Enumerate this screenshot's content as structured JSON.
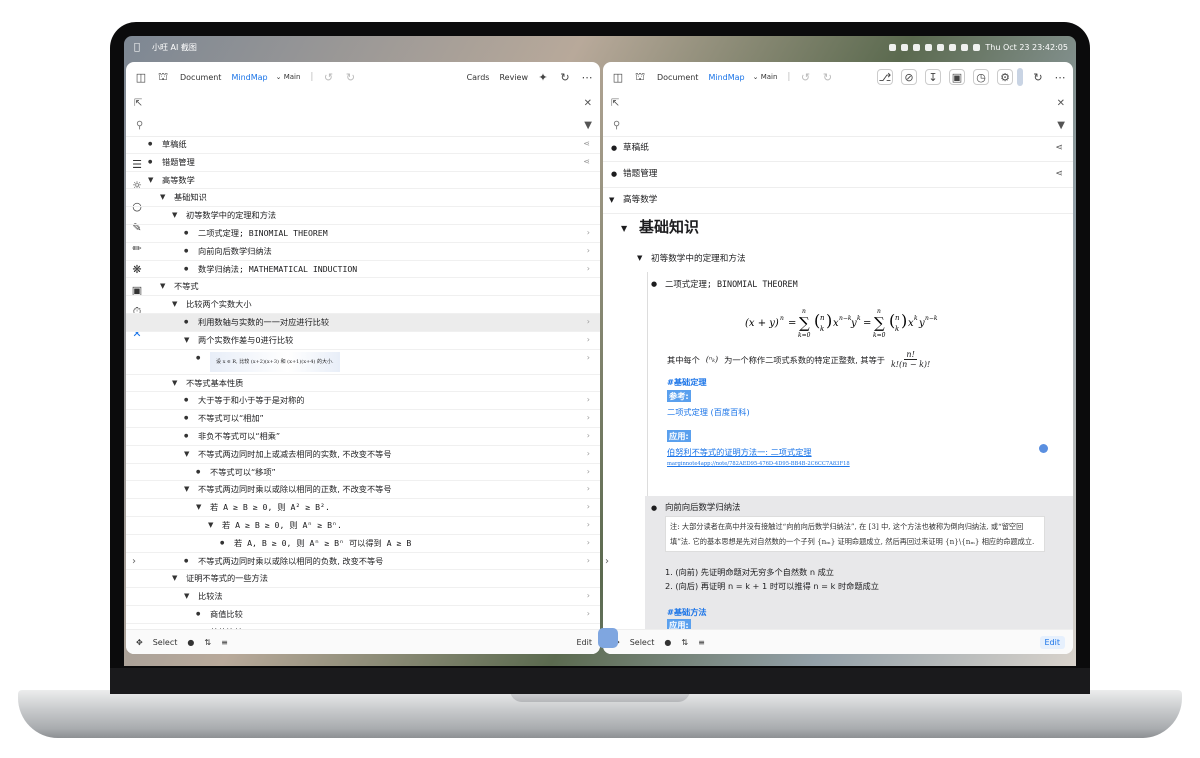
{
  "menubar": {
    "app_name": "小旺 AI 截图",
    "datetime": "Thu Oct 23  23:42:05"
  },
  "left": {
    "toolbar": {
      "document": "Document",
      "mindmap": "MindMap",
      "main": "Main",
      "cards": "Cards",
      "review": "Review"
    },
    "tree": [
      {
        "depth": 0,
        "label": "草稿纸",
        "bullet": true
      },
      {
        "depth": 0,
        "label": "错题管理",
        "bullet": true
      },
      {
        "depth": 0,
        "label": "高等数学",
        "toggle": true
      },
      {
        "depth": 1,
        "label": "基础知识",
        "toggle": true
      },
      {
        "depth": 2,
        "label": "初等数学中的定理和方法",
        "toggle": true
      },
      {
        "depth": 3,
        "label": "二项式定理; BINOMIAL THEOREM",
        "bullet": true
      },
      {
        "depth": 3,
        "label": "向前向后数学归纳法",
        "bullet": true
      },
      {
        "depth": 3,
        "label": "数学归纳法; MATHEMATICAL INDUCTION",
        "bullet": true
      },
      {
        "depth": 1,
        "label": "不等式",
        "toggle": true
      },
      {
        "depth": 2,
        "label": "比较两个实数大小",
        "toggle": true
      },
      {
        "depth": 3,
        "label": "利用数轴与实数的一一对应进行比较",
        "bullet": true,
        "highlight": true
      },
      {
        "depth": 3,
        "label": "两个实数作差与0进行比较",
        "toggle": true
      },
      {
        "depth": 4,
        "label": "设 x ∈ R, 比较 (x+2)(x+3) 和 (x+1)(x+4) 的大小.",
        "bullet": true,
        "image": true
      },
      {
        "depth": 2,
        "label": "不等式基本性质",
        "toggle": true
      },
      {
        "depth": 3,
        "label": "大于等于和小于等于是对称的",
        "bullet": true
      },
      {
        "depth": 3,
        "label": "不等式可以“相加”",
        "bullet": true
      },
      {
        "depth": 3,
        "label": "非负不等式可以“相乘”",
        "bullet": true
      },
      {
        "depth": 3,
        "label": "不等式两边同时加上或减去相同的实数, 不改变不等号",
        "toggle": true
      },
      {
        "depth": 4,
        "label": "不等式可以“移项”",
        "bullet": true
      },
      {
        "depth": 3,
        "label": "不等式两边同时乘以或除以相同的正数, 不改变不等号",
        "toggle": true
      },
      {
        "depth": 4,
        "label": "若 A ≥ B ≥ 0, 则 A² ≥ B².",
        "toggle": true
      },
      {
        "depth": 5,
        "label": "若 A ≥ B ≥ 0, 则 Aⁿ ≥ Bⁿ.",
        "toggle": true
      },
      {
        "depth": 6,
        "label": "若 A, B ≥ 0, 则 Aⁿ ≥ Bⁿ 可以得到 A ≥ B",
        "bullet": true
      },
      {
        "depth": 3,
        "label": "不等式两边同时乘以或除以相同的负数, 改变不等号",
        "bullet": true
      },
      {
        "depth": 2,
        "label": "证明不等式的一些方法",
        "toggle": true
      },
      {
        "depth": 3,
        "label": "比较法",
        "toggle": true
      },
      {
        "depth": 4,
        "label": "商值比较",
        "bullet": true
      },
      {
        "depth": 4,
        "label": "差值比较",
        "bullet": true
      }
    ],
    "bottom": {
      "select": "Select",
      "edit": "Edit"
    }
  },
  "right": {
    "toolbar": {
      "document": "Document",
      "mindmap": "MindMap",
      "main": "Main"
    },
    "top_items": [
      "草稿纸",
      "错题管理",
      "高等数学"
    ],
    "section_title": "基础知识",
    "subsection": "初等数学中的定理和方法",
    "binomial": {
      "title": "二项式定理; BINOMIAL THEOREM",
      "formula": "(x + y)ⁿ = Σₖ₌₀ⁿ (n k) xⁿ⁻ᵏ yᵏ = Σₖ₌₀ⁿ (n k) xᵏ yⁿ⁻ᵏ",
      "desc_a": "其中每个",
      "desc_b": "为一个称作二项式系数的特定正整数, 其等于",
      "desc_frac": "n! / k!(n − k)!",
      "tag": "#基础定理",
      "ref_label": "参考:",
      "ref_text": "二项式定理 (百度百科)",
      "app_label": "应用:",
      "app_link": "伯努利不等式的证明方法一: 二项式定理",
      "app_url": "marginnote4app://note/782AED95-476D-4D95-BB4B-2C6CC7A83F18"
    },
    "induction": {
      "title": "向前向后数学归纳法",
      "note": "注: 大部分读者在高中并没有接触过“向前向后数学归纳法”, 在 [3] 中, 这个方法也被称为倒向归纳法, 或“留空回填”法. 它的基本思想是先对自然数的一个子列 {nₘ} 证明命题成立, 然后再回过来证明 {n}\\{nₘ} 相应的命题成立.",
      "step1": "1.  (向前) 先证明命题对无穷多个自然数 n 成立",
      "step2": "2.  (向后) 再证明 n = k + 1 时可以推得 n = k 时命题成立",
      "tag": "#基础方法",
      "app_label": "应用:"
    },
    "bottom": {
      "select": "Select",
      "edit": "Edit"
    }
  }
}
